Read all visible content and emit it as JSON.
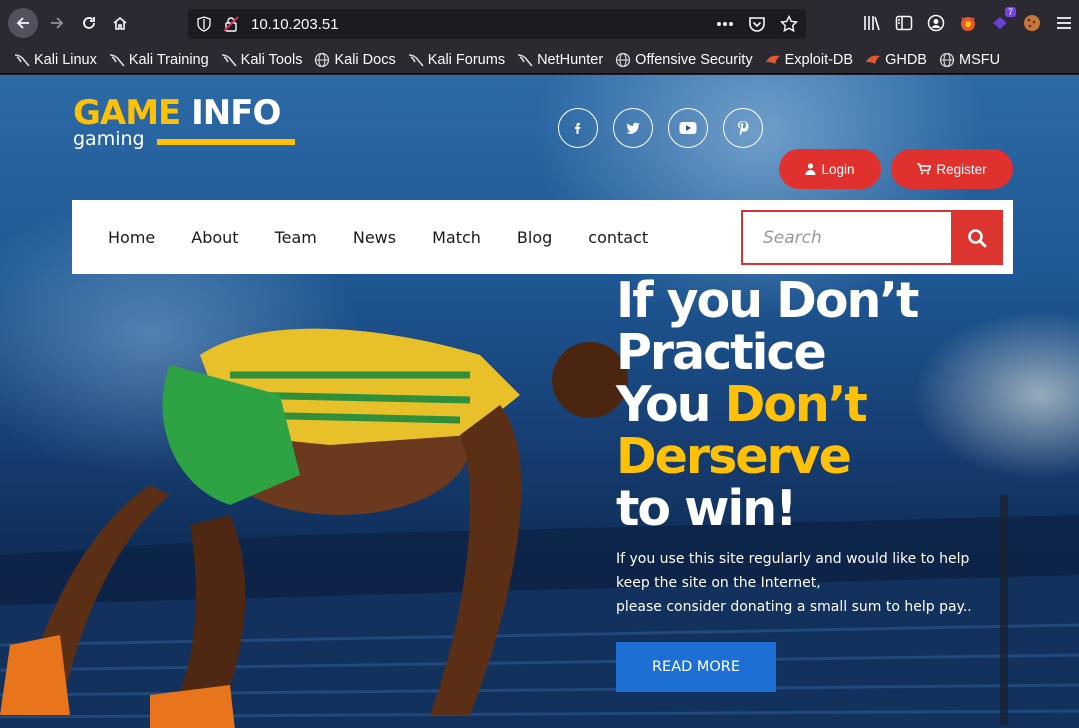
{
  "browser": {
    "url": "10.10.203.51",
    "extension_badge": "7",
    "bookmarks": [
      {
        "label": "Kali Linux",
        "icon": "kali-dragon-icon"
      },
      {
        "label": "Kali Training",
        "icon": "kali-dragon-icon"
      },
      {
        "label": "Kali Tools",
        "icon": "kali-dragon-icon"
      },
      {
        "label": "Kali Docs",
        "icon": "globe-icon"
      },
      {
        "label": "Kali Forums",
        "icon": "kali-dragon-icon"
      },
      {
        "label": "NetHunter",
        "icon": "kali-dragon-icon"
      },
      {
        "label": "Offensive Security",
        "icon": "globe-icon"
      },
      {
        "label": "Exploit-DB",
        "icon": "exploitdb-icon"
      },
      {
        "label": "GHDB",
        "icon": "exploitdb-icon"
      },
      {
        "label": "MSFU",
        "icon": "globe-icon"
      }
    ]
  },
  "site": {
    "logo_part1": "GAME",
    "logo_part2": "INFO",
    "logo_sub": "gaming",
    "social": [
      "facebook-icon",
      "twitter-icon",
      "youtube-icon",
      "pinterest-icon"
    ],
    "login_label": "Login",
    "register_label": "Register",
    "menu": [
      "Home",
      "About",
      "Team",
      "News",
      "Match",
      "Blog",
      "contact"
    ],
    "search_placeholder": "Search",
    "headline": {
      "line1": "If you Don’t",
      "line2": "Practice",
      "line3_white": "You ",
      "line3_yellow": "Don’t",
      "line4": "Derserve",
      "line5": "to win!"
    },
    "description": {
      "line1": "If you use this site regularly and would like to help",
      "line2": "keep the site on the Internet,",
      "line3": "please consider donating a small sum to help pay.."
    },
    "read_more_label": "READ MORE"
  },
  "colors": {
    "accent_yellow": "#ffc107",
    "accent_red": "#dc3530",
    "button_blue": "#1d6fd3"
  }
}
